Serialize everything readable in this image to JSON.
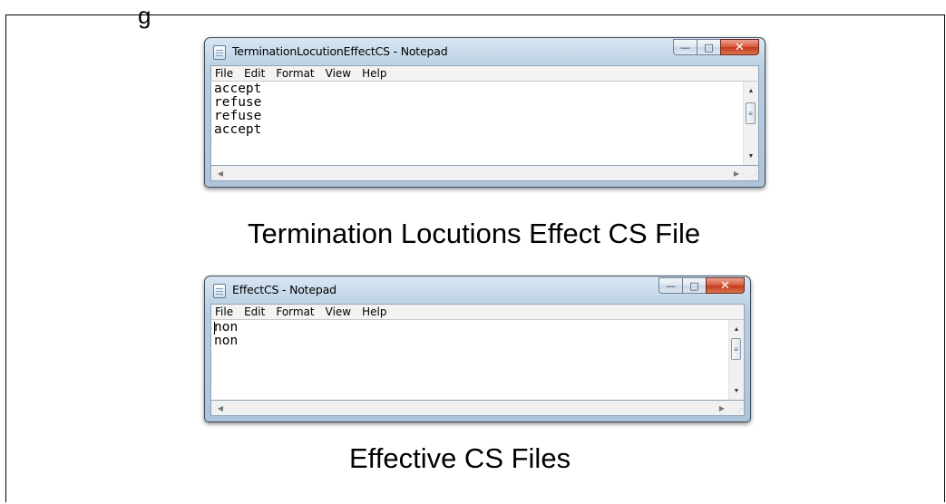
{
  "top_text": "g",
  "windows": [
    {
      "title": "TerminationLocutionEffectCS - Notepad",
      "menu": [
        "File",
        "Edit",
        "Format",
        "View",
        "Help"
      ],
      "content": "accept\nrefuse\nrefuse\naccept",
      "controls": {
        "minimize": "—",
        "maximize": "□",
        "close": "✕"
      },
      "icon": "notepad-icon"
    },
    {
      "title": "EffectCS - Notepad",
      "menu": [
        "File",
        "Edit",
        "Format",
        "View",
        "Help"
      ],
      "content": "non\nnon",
      "controls": {
        "minimize": "—",
        "maximize": "□",
        "close": "✕"
      },
      "icon": "notepad-icon"
    }
  ],
  "captions": {
    "first": "Termination Locutions Effect CS File",
    "second": "Effective CS Files"
  },
  "scrollbar_glyphs": {
    "up": "▲",
    "down": "▼",
    "left": "◀",
    "right": "▶",
    "thumb": "≡",
    "grip": "⋰"
  }
}
